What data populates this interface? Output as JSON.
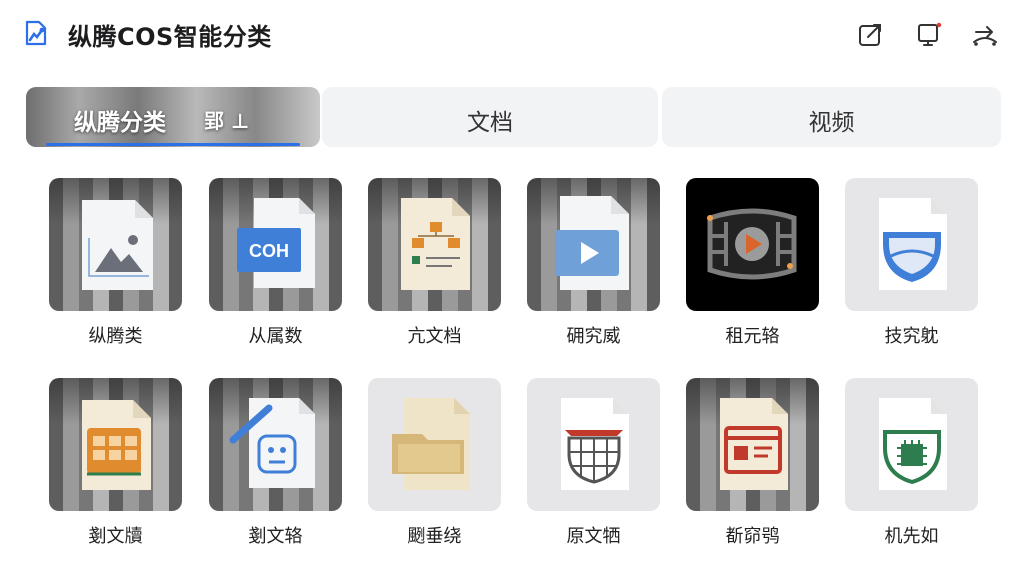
{
  "header": {
    "app_title": "纵腾COS智能分类",
    "icons": [
      "app-logo-icon",
      "export-icon",
      "monitor-icon",
      "transfer-icon"
    ]
  },
  "tabs": {
    "items": [
      {
        "label": "纵腾分类",
        "extra": "郢 ⊥",
        "active": true
      },
      {
        "label": "文档",
        "active": false
      },
      {
        "label": "视频",
        "active": false
      }
    ]
  },
  "grid": {
    "items": [
      {
        "label": "纵腾类",
        "icon": "image-file-icon"
      },
      {
        "label": "从属数",
        "icon": "coh-document-icon"
      },
      {
        "label": "亢文档",
        "icon": "diagram-document-icon"
      },
      {
        "label": "砽究威",
        "icon": "video-file-icon"
      },
      {
        "label": "租元辂",
        "icon": "film-reel-icon"
      },
      {
        "label": "技究躭",
        "icon": "shield-document-icon"
      },
      {
        "label": "剗文牘",
        "icon": "spreadsheet-file-icon"
      },
      {
        "label": "剗文辂",
        "icon": "edit-document-icon"
      },
      {
        "label": "颲垂绕",
        "icon": "folder-file-icon"
      },
      {
        "label": "原文牺",
        "icon": "basket-document-icon"
      },
      {
        "label": "斱窌鸮",
        "icon": "web-page-file-icon"
      },
      {
        "label": "机先如",
        "icon": "chip-shield-icon"
      }
    ]
  },
  "colors": {
    "accent": "#2d6fe6",
    "tab_bg": "#f2f3f5",
    "doc_blue": "#3f7fd8",
    "doc_red": "#c0392b",
    "doc_green": "#2e7d4f"
  }
}
